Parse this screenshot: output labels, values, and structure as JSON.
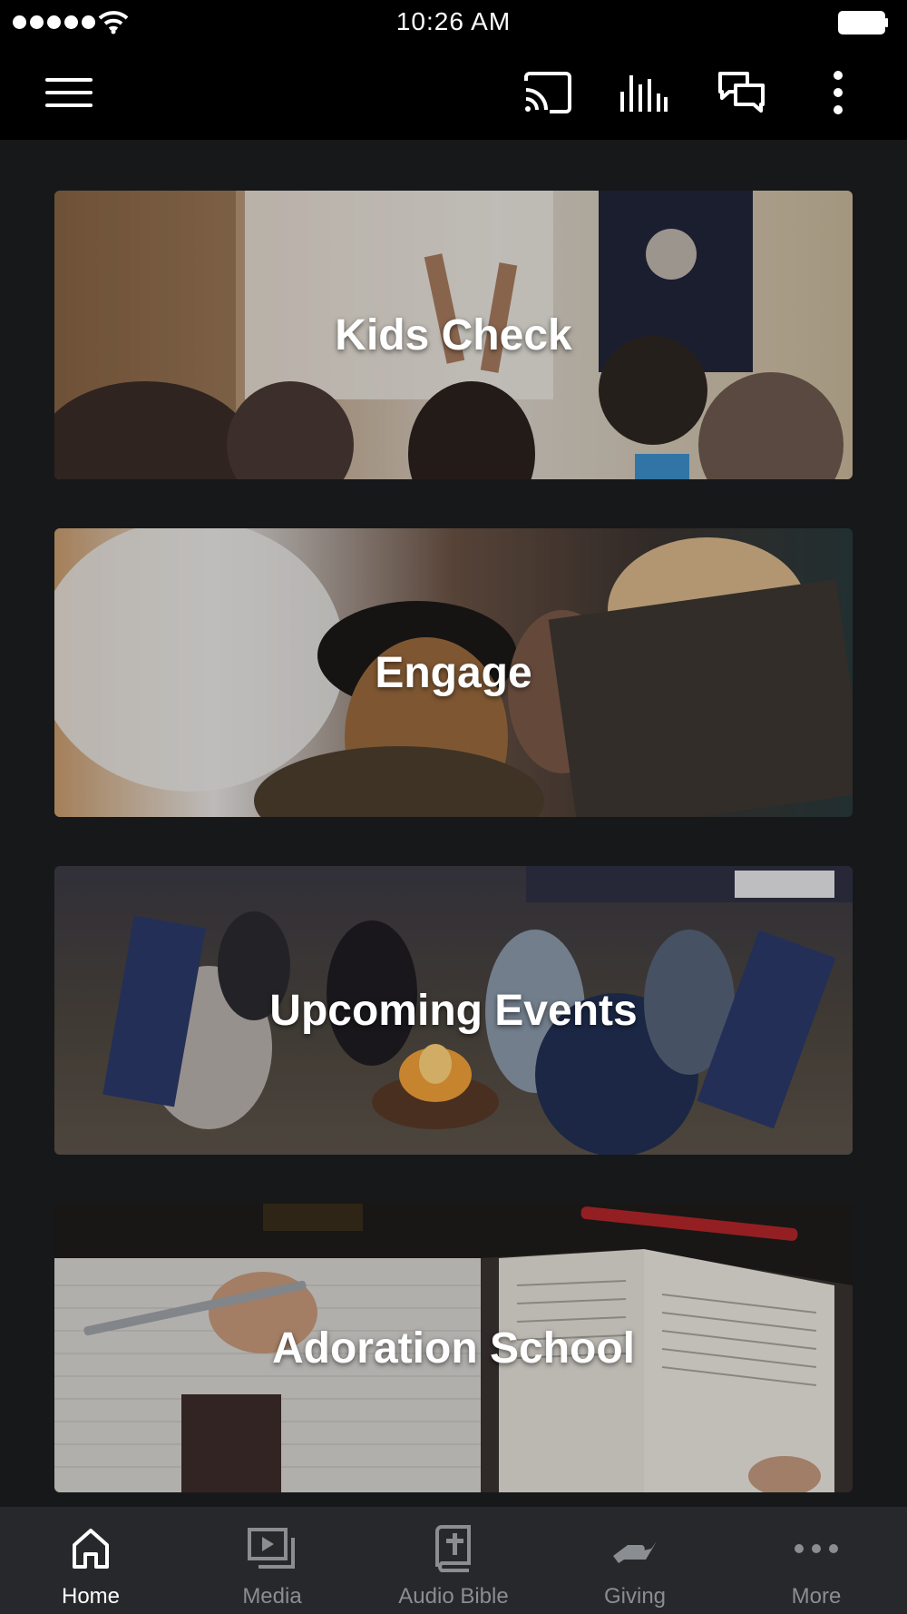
{
  "status_bar": {
    "time": "10:26 AM"
  },
  "toolbar": {
    "icons": [
      "menu-icon",
      "cast-icon",
      "audio-levels-icon",
      "chat-icon",
      "more-vertical-icon"
    ]
  },
  "cards": [
    {
      "title": "Kids Check"
    },
    {
      "title": "Engage"
    },
    {
      "title": "Upcoming Events"
    },
    {
      "title": "Adoration School"
    }
  ],
  "tabbar": {
    "tabs": [
      {
        "label": "Home",
        "icon": "home-icon",
        "active": true
      },
      {
        "label": "Media",
        "icon": "media-icon",
        "active": false
      },
      {
        "label": "Audio Bible",
        "icon": "bible-icon",
        "active": false
      },
      {
        "label": "Giving",
        "icon": "giving-icon",
        "active": false
      },
      {
        "label": "More",
        "icon": "more-horizontal-icon",
        "active": false
      }
    ]
  },
  "colors": {
    "background": "#17181a",
    "toolbar": "#000000",
    "tabbar": "#26282b",
    "tab_inactive": "#8a8d92",
    "tab_active": "#ffffff"
  }
}
